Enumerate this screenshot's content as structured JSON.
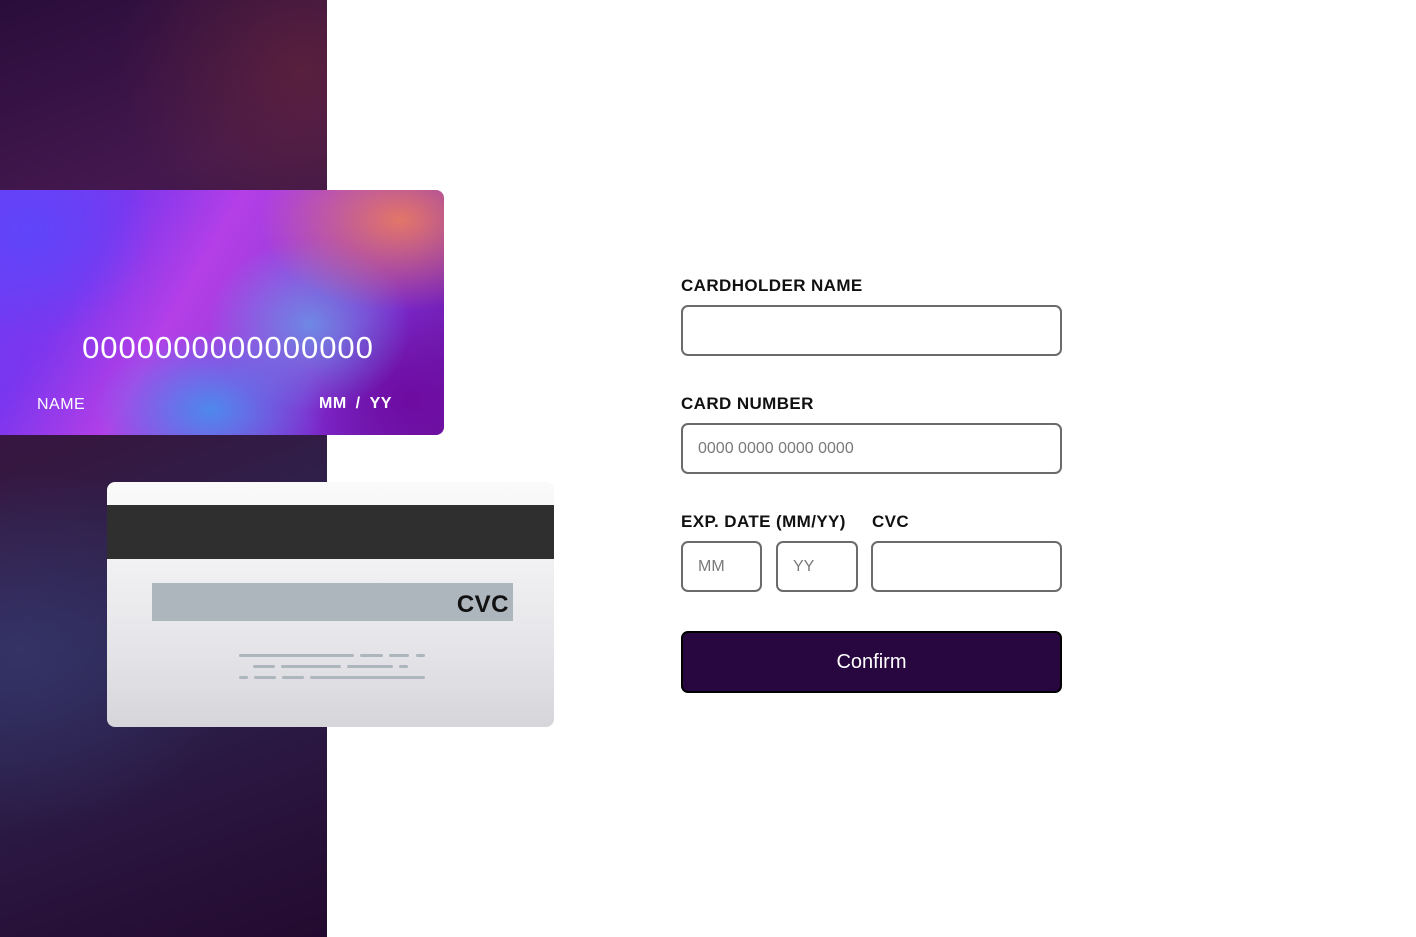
{
  "colors": {
    "side_panel": "#2a0d3b",
    "button_background": "#28063f",
    "button_text": "#ffffff",
    "cvc_strip": "#adb5bd",
    "magnetic_stripe": "#2f2f2f"
  },
  "card_front": {
    "number": "0000000000000000",
    "name": "NAME",
    "exp_month": "MM",
    "exp_separator": "/",
    "exp_year": "YY"
  },
  "card_back": {
    "cvc": "CVC"
  },
  "form": {
    "cardholder_label": "CARDHOLDER NAME",
    "cardholder_value": "",
    "cardholder_placeholder": "",
    "card_number_label": "CARD NUMBER",
    "card_number_value": "",
    "card_number_placeholder": "0000 0000 0000 0000",
    "exp_label": "EXP. DATE (MM/YY)",
    "exp_month_placeholder": "MM",
    "exp_year_placeholder": "YY",
    "cvc_label": "CVC",
    "cvc_value": "",
    "cvc_placeholder": "",
    "confirm_label": "Confirm"
  }
}
